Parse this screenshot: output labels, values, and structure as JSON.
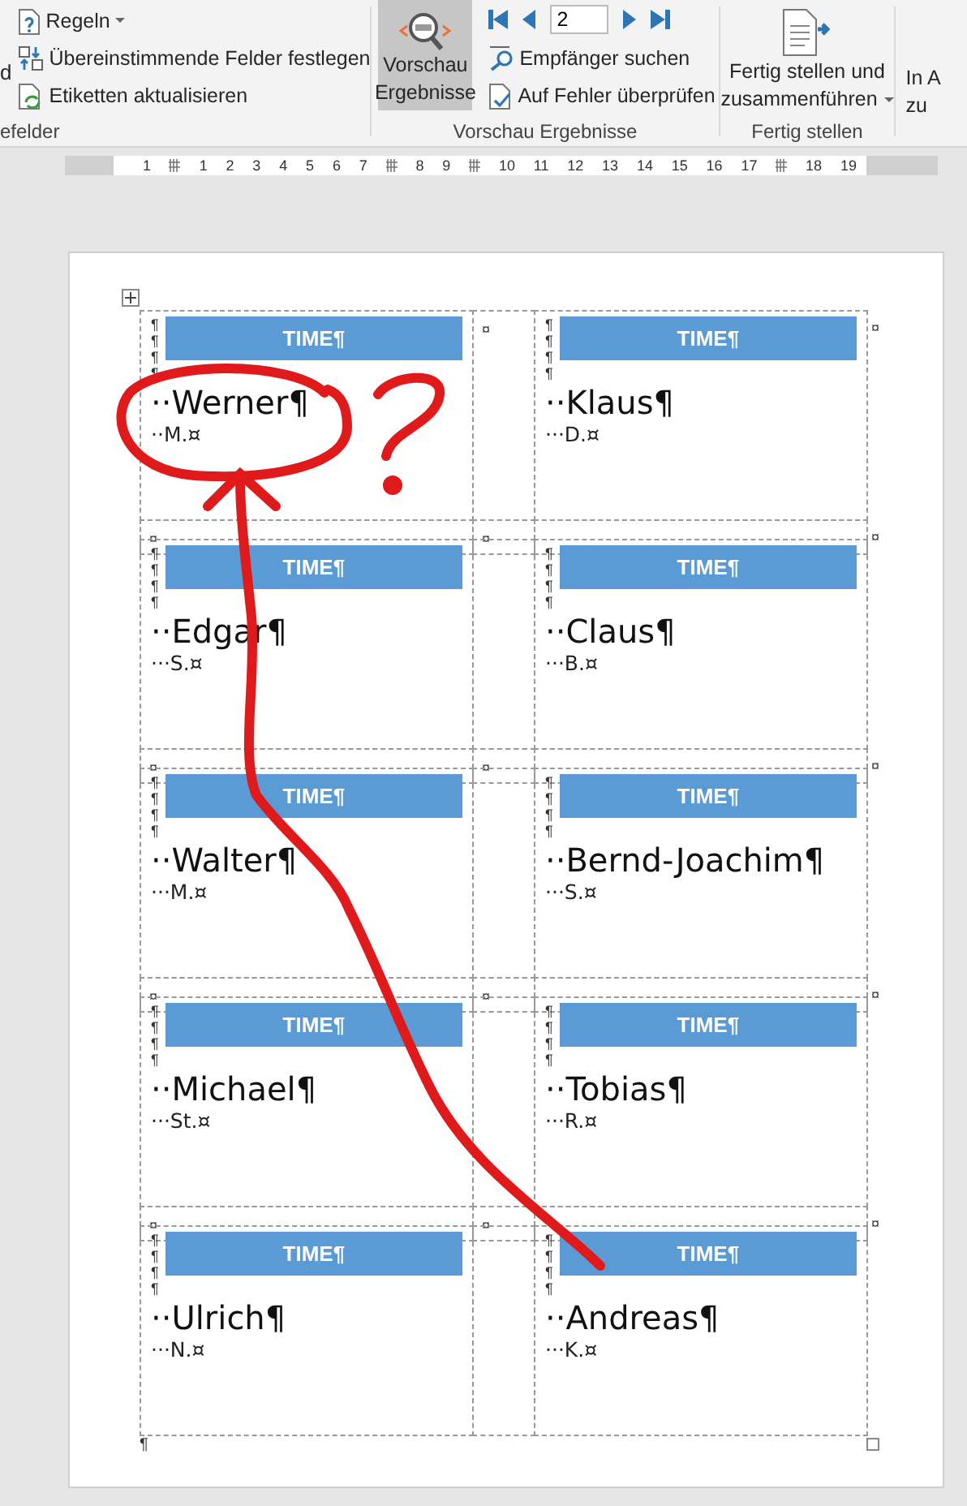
{
  "ribbon": {
    "cut_button": "d",
    "rules": {
      "text": "Regeln",
      "dropdown": true
    },
    "match_fields": "Übereinstimmende Felder festlegen",
    "update_labels": "Etiketten aktualisieren",
    "group_1_label": "efelder",
    "preview_button": {
      "lines": [
        "Vorschau",
        "Ergebnisse"
      ],
      "selected": true
    },
    "record_field": {
      "value": "2"
    },
    "find_recipient": "Empfänger suchen",
    "check_errors": "Auf Fehler überprüfen",
    "group_2_label": "Vorschau Ergebnisse",
    "finish_button": {
      "lines": [
        "Fertig stellen und",
        "zusammenführen"
      ],
      "dropdown": true
    },
    "group_3_label": "Fertig stellen",
    "cut_group_button": {
      "lines": [
        "In A",
        "zu"
      ]
    }
  },
  "ruler": {
    "marks": [
      {
        "kind": "number",
        "text": "1"
      },
      {
        "kind": "marker"
      },
      {
        "kind": "number",
        "text": "1"
      },
      {
        "kind": "number",
        "text": "2"
      },
      {
        "kind": "number",
        "text": "3"
      },
      {
        "kind": "number",
        "text": "4"
      },
      {
        "kind": "number",
        "text": "5"
      },
      {
        "kind": "number",
        "text": "6"
      },
      {
        "kind": "number",
        "text": "7"
      },
      {
        "kind": "marker"
      },
      {
        "kind": "number",
        "text": "8"
      },
      {
        "kind": "number",
        "text": "9"
      },
      {
        "kind": "marker"
      },
      {
        "kind": "number",
        "text": "10"
      },
      {
        "kind": "number",
        "text": "11"
      },
      {
        "kind": "number",
        "text": "12"
      },
      {
        "kind": "number",
        "text": "13"
      },
      {
        "kind": "number",
        "text": "14"
      },
      {
        "kind": "number",
        "text": "15"
      },
      {
        "kind": "number",
        "text": "16"
      },
      {
        "kind": "number",
        "text": "17"
      },
      {
        "kind": "marker"
      },
      {
        "kind": "number",
        "text": "18"
      },
      {
        "kind": "number",
        "text": "19"
      }
    ]
  },
  "document": {
    "rows": [
      {
        "spacer_mark": "¤",
        "end_mark": "¤",
        "labels": [
          {
            "margin_marks": [
              "¶",
              "¶",
              "¶",
              "¶"
            ],
            "header": "TIME¶",
            "name": "··Werner¶",
            "detail": "··M.¤"
          },
          {
            "margin_marks": [
              "¶",
              "¶",
              "¶",
              "¶"
            ],
            "header": "TIME¶",
            "name": "··Klaus¶",
            "detail": "···D.¤"
          }
        ],
        "gap_marks": [
          "¤",
          "¤",
          "¤"
        ]
      },
      {
        "labels": [
          {
            "margin_marks": [
              "¶",
              "¶",
              "¶",
              "¶"
            ],
            "header": "TIME¶",
            "name": "··Edgar¶",
            "detail": "···S.¤"
          },
          {
            "margin_marks": [
              "¶",
              "¶",
              "¶",
              "¶"
            ],
            "header": "TIME¶",
            "name": "··Claus¶",
            "detail": "···B.¤"
          }
        ],
        "gap_marks": [
          "¤",
          "¤",
          "¤"
        ]
      },
      {
        "labels": [
          {
            "margin_marks": [
              "¶",
              "¶",
              "¶",
              "¶"
            ],
            "header": "TIME¶",
            "name": "··Walter¶",
            "detail": "···M.¤"
          },
          {
            "margin_marks": [
              "¶",
              "¶",
              "¶",
              "¶"
            ],
            "header": "TIME¶",
            "name": "··Bernd-Joachim¶",
            "detail": "···S.¤"
          }
        ],
        "gap_marks": [
          "¤",
          "¤",
          "¤"
        ]
      },
      {
        "labels": [
          {
            "margin_marks": [
              "¶",
              "¶",
              "¶",
              "¶"
            ],
            "header": "TIME¶",
            "name": "··Michael¶",
            "detail": "···St.¤"
          },
          {
            "margin_marks": [
              "¶",
              "¶",
              "¶",
              "¶"
            ],
            "header": "TIME¶",
            "name": "··Tobias¶",
            "detail": "···R.¤"
          }
        ],
        "gap_marks": [
          "¤",
          "¤",
          "¤"
        ]
      },
      {
        "labels": [
          {
            "margin_marks": [
              "¶",
              "¶",
              "¶",
              "¶"
            ],
            "header": "TIME¶",
            "name": "··Ulrich¶",
            "detail": "···N.¤"
          },
          {
            "margin_marks": [
              "¶",
              "¶",
              "¶",
              "¶"
            ],
            "header": "TIME¶",
            "name": "··Andreas¶",
            "detail": "···K.¤"
          }
        ]
      }
    ],
    "end_paragraph": "¶"
  }
}
